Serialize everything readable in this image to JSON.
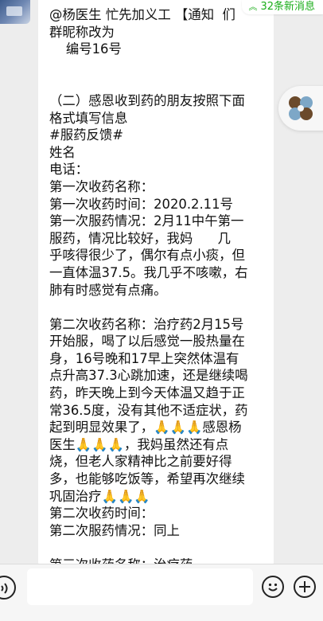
{
  "message": {
    "lines": [
      "@杨医生 忙先加义工 【通知  们",
      "群昵称改为",
      "    编号16号",
      "",
      "",
      "（二）感恩收到药的朋友按照下面",
      "格式填写信息",
      "#服药反馈#",
      "姓名",
      "电话：",
      "第一次收药名称：",
      "第一次收药时间：2020.2.11号",
      "第一次服药情况：2月11中午第一",
      "服药，情况比较好，我妈      几",
      "乎咳得很少了，偶尔有点小痰，但",
      "一直体温37.5。我几乎不咳嗽，右",
      "肺有时感觉有点痛。",
      "",
      "第二次收药名称：治疗药2月15号",
      "开始服，喝了以后感觉一股热量在",
      "身，16号晚和17早上突然体温有",
      "点升高37.3心跳加速，还是继续喝",
      "药，昨天晚上到今天体温又趋于正",
      "常36.5度，没有其他不适症状，药",
      "起到明显效果了，🙏🙏🙏感恩杨",
      "医生🙏🙏🙏，我妈虽然还有点",
      "烧，但老人家精神比之前要好得",
      "多，也能够吃饭等，希望再次继续",
      "巩固治疗🙏🙏🙏",
      "第二次收药时间：",
      "第二次服药情况：同上",
      "",
      "第三次收药名称：治疗药"
    ]
  },
  "badge": {
    "text": "32条新消息",
    "icon": "double-chevron-up-icon"
  },
  "floating": {
    "icon": "pinwheel-icon"
  },
  "bottombar": {
    "voice_icon": "voice-icon",
    "emoji_icon": "emoji-icon",
    "plus_icon": "plus-icon"
  }
}
